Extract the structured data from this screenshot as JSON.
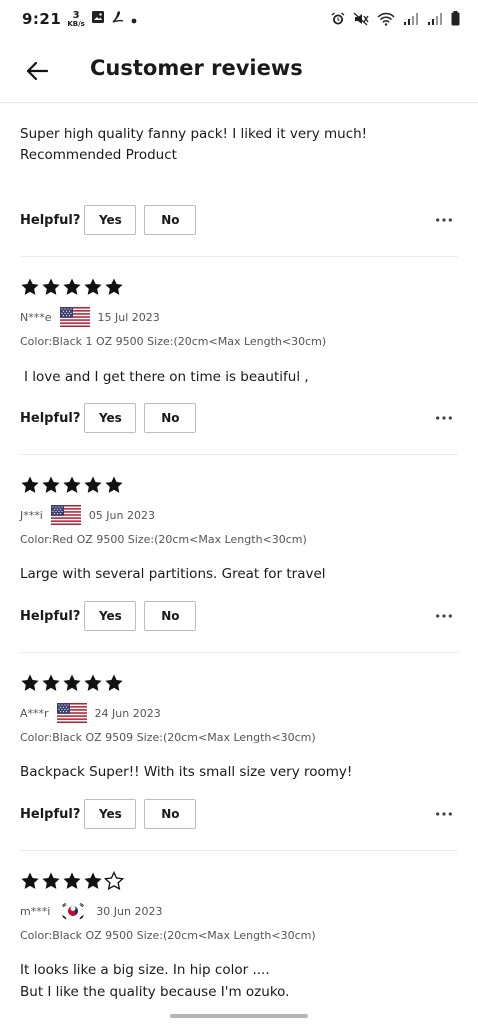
{
  "status": {
    "time": "9:21",
    "kbs_value": "3",
    "kbs_unit": "KB/s"
  },
  "header": {
    "title": "Customer reviews"
  },
  "helpful": {
    "label": "Helpful?",
    "yes": "Yes",
    "no": "No"
  },
  "reviews": [
    {
      "text": "Super high quality fanny pack! I liked it very much! Recommended Product"
    },
    {
      "rating": 5,
      "author": "N***e",
      "country": "US",
      "date": "15 Jul 2023",
      "variant": "Color:Black 1 OZ 9500 Size:(20cm<Max Length<30cm)",
      "text": "I love and I get there on time is beautiful ,"
    },
    {
      "rating": 5,
      "author": "J***i",
      "country": "US",
      "date": "05 Jun 2023",
      "variant": "Color:Red OZ 9500 Size:(20cm<Max Length<30cm)",
      "text": "Large with several partitions. Great for travel"
    },
    {
      "rating": 5,
      "author": "A***r",
      "country": "US",
      "date": "24 Jun 2023",
      "variant": "Color:Black OZ 9509 Size:(20cm<Max Length<30cm)",
      "text": "Backpack Super!! With its small size very roomy!"
    },
    {
      "rating": 4,
      "author": "m***i",
      "country": "KR",
      "date": "30 Jun 2023",
      "variant": "Color:Black OZ 9500 Size:(20cm<Max Length<30cm)",
      "text": "It looks like a big size. In hip color ....",
      "text2": "But I like the quality because I'm ozuko."
    }
  ]
}
